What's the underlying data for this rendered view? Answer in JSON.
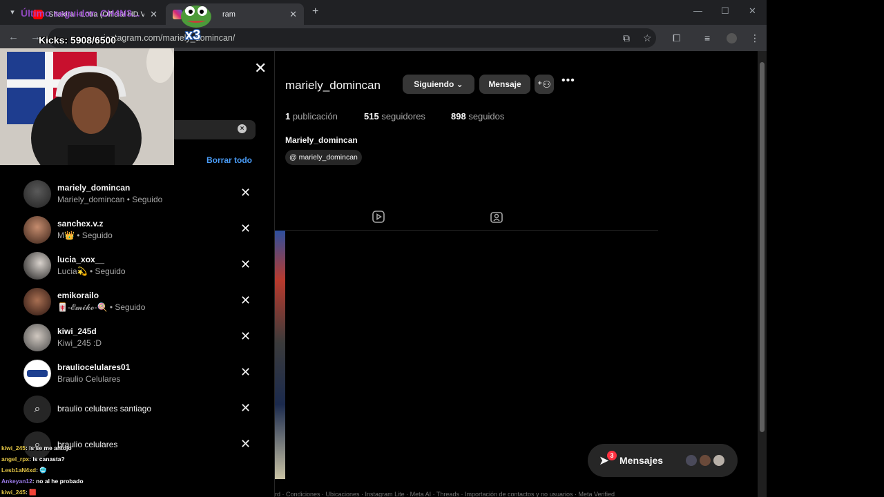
{
  "browser": {
    "tabs": [
      {
        "title": "Shakira - Loba (Official HD Vid",
        "active": false
      },
      {
        "title": "ram",
        "active": true
      }
    ],
    "url": "instagram.com/mariely_domincan/"
  },
  "stream": {
    "kicks": "Kicks: 5908/6500",
    "last_follower": "Último seguidor: CH4N3...",
    "emote_multiplier": "x3",
    "chat": [
      {
        "user": "kiwi_245",
        "text": "ls se me antojo"
      },
      {
        "user": "angel_rpx",
        "text": "ls canasta?"
      },
      {
        "user": "Lesb1aN4xd",
        "text": ""
      },
      {
        "user": "Ankeyan12",
        "text": "no al he probado"
      },
      {
        "user": "kiwi_245",
        "text": ""
      }
    ]
  },
  "search_panel": {
    "clear_all": "Borrar todo",
    "recent": [
      {
        "username": "mariely_domincan",
        "subtitle": "Mariely_domincan • Seguido",
        "avatar_color": "#3a3a3a"
      },
      {
        "username": "sanchex.v.z",
        "subtitle": "M👑 • Seguido",
        "avatar_color": "#8a5a4a"
      },
      {
        "username": "lucia_xox__",
        "subtitle": "Lucia💫 • Seguido",
        "avatar_color": "#2a2a2a"
      },
      {
        "username": "emikorailo",
        "subtitle": "🀄-𝓔𝓶𝓲𝓴𝓸-🍭 • Seguido",
        "avatar_color": "#4a3028"
      },
      {
        "username": "kiwi_245d",
        "subtitle": "Kiwi_245 :D",
        "avatar_color": "#6a6a6a"
      },
      {
        "username": "brauliocelulares01",
        "subtitle": "Braulio Celulares",
        "avatar_color": "#ffffff"
      }
    ],
    "recent_searches": [
      {
        "text": "braulio celulares santiago"
      },
      {
        "text": "braulio celulares"
      }
    ]
  },
  "profile": {
    "username": "mariely_domincan",
    "follow_button": "Siguiendo",
    "message_button": "Mensaje",
    "posts_count": "1",
    "posts_label": "publicación",
    "followers_count": "515",
    "followers_label": "seguidores",
    "following_count": "898",
    "following_label": "seguidos",
    "full_name": "Mariely_domincan",
    "threads_handle": "mariely_domincan"
  },
  "messages_widget": {
    "label": "Mensajes",
    "badge": "3"
  },
  "footer": "rd · Condiciones · Ubicaciones · Instagram Lite · Meta AI · Threads · Importación de contactos y no usuarios · Meta Verified",
  "icons": [
    "search-icon",
    "close-icon",
    "reels-icon",
    "tagged-icon",
    "add-person-icon",
    "more-icon",
    "send-icon",
    "threads-icon"
  ]
}
